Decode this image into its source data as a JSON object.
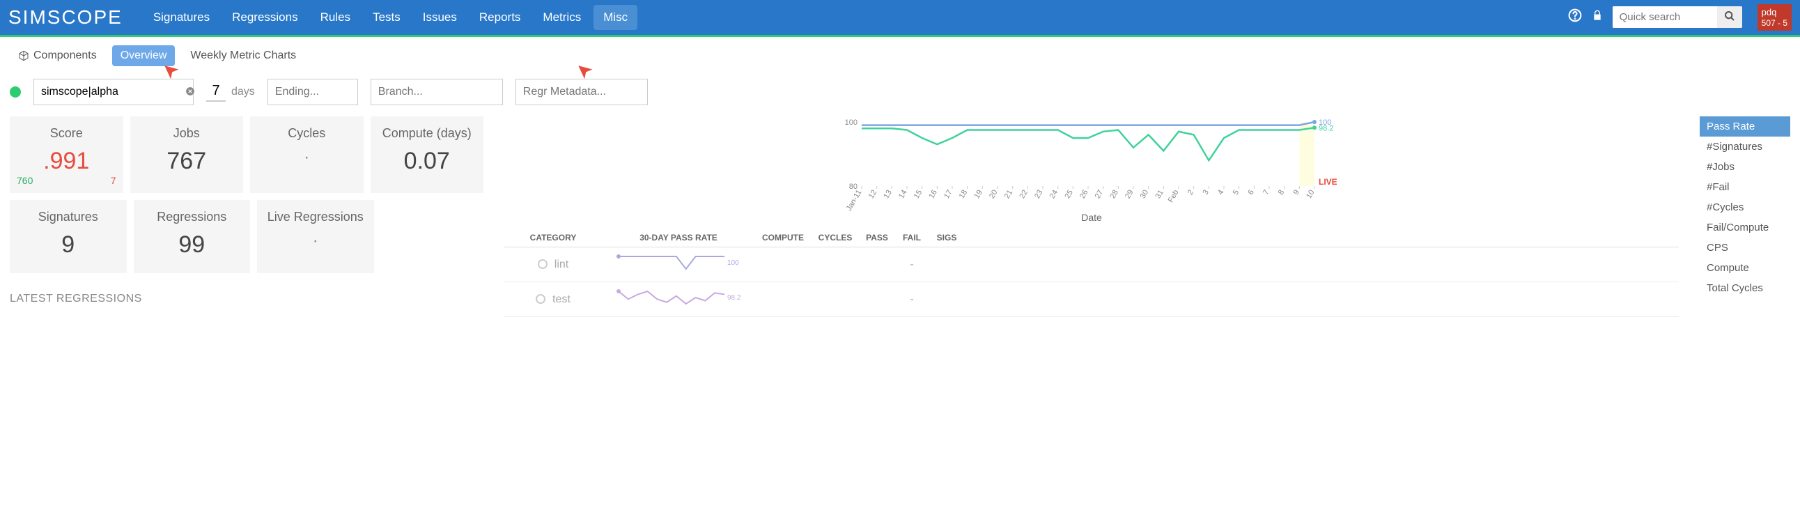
{
  "logo": "SIMSCOPE",
  "nav": {
    "items": [
      "Signatures",
      "Regressions",
      "Rules",
      "Tests",
      "Issues",
      "Reports",
      "Metrics",
      "Misc"
    ],
    "active": "Misc",
    "search_placeholder": "Quick search",
    "pdq": {
      "line1": "pdq",
      "line2": "507 - 5"
    }
  },
  "subnav": {
    "items": [
      "Components",
      "Overview",
      "Weekly Metric Charts"
    ],
    "active": "Overview"
  },
  "filters": {
    "component_value": "simscope|alpha",
    "days_value": "7",
    "days_label": "days",
    "ending_placeholder": "Ending...",
    "branch_placeholder": "Branch...",
    "regr_placeholder": "Regr Metadata..."
  },
  "stats": {
    "score": {
      "title": "Score",
      "value": ".991",
      "footer_left": "760",
      "footer_right": "7"
    },
    "jobs": {
      "title": "Jobs",
      "value": "767"
    },
    "cycles": {
      "title": "Cycles",
      "value": "·"
    },
    "compute": {
      "title": "Compute (days)",
      "value": "0.07"
    },
    "signatures": {
      "title": "Signatures",
      "value": "9"
    },
    "regressions": {
      "title": "Regressions",
      "value": "99"
    },
    "live_regressions": {
      "title": "Live Regressions",
      "value": "·"
    }
  },
  "chart_data": {
    "type": "line",
    "title": "",
    "xlabel": "Date",
    "ylabel": "",
    "ylim": [
      80,
      100
    ],
    "x_ticks": [
      "Jan-11",
      "12",
      "13",
      "14",
      "15",
      "16",
      "17",
      "18",
      "19",
      "20",
      "21",
      "22",
      "23",
      "24",
      "25",
      "26",
      "27",
      "28",
      "29",
      "30",
      "31",
      "Feb",
      "2",
      "3",
      "4",
      "5",
      "6",
      "7",
      "8",
      "9",
      "10"
    ],
    "series": [
      {
        "name": "blue",
        "color": "#7da4e8",
        "end_label": "100",
        "values": [
          99,
          99,
          99,
          99,
          99,
          99,
          99,
          99,
          99,
          99,
          99,
          99,
          99,
          99,
          99,
          99,
          99,
          99,
          99,
          99,
          99,
          99,
          99,
          99,
          99,
          99,
          99,
          99,
          99,
          99,
          100
        ]
      },
      {
        "name": "green",
        "color": "#3fd39b",
        "end_label": "98.2",
        "values": [
          98,
          98,
          98,
          97.5,
          95,
          93,
          95,
          97.5,
          97.5,
          97.5,
          97.5,
          97.5,
          97.5,
          97.5,
          95,
          95,
          97,
          97.5,
          92,
          96,
          91,
          97,
          96,
          88,
          95,
          97.5,
          97.5,
          97.5,
          97.5,
          97.5,
          98.2
        ]
      }
    ],
    "live_label": "LIVE"
  },
  "category_table": {
    "headers": {
      "cat": "CATEGORY",
      "spark": "30-DAY PASS RATE",
      "compute": "COMPUTE",
      "cycles": "CYCLES",
      "pass": "PASS",
      "fail": "FAIL",
      "sigs": "SIGS"
    },
    "rows": [
      {
        "name": "lint",
        "spark_label": "100",
        "spark_color": "#a9a9e0",
        "values": [
          100,
          100,
          100,
          100,
          100,
          100,
          100,
          95,
          100,
          100,
          100,
          100
        ],
        "fail": "-"
      },
      {
        "name": "test",
        "spark_label": "98.2",
        "spark_color": "#c9a9e0",
        "values": [
          100,
          95,
          98,
          100,
          95,
          93,
          97,
          92,
          96,
          94,
          99,
          98
        ],
        "fail": "-"
      }
    ]
  },
  "metrics_list": {
    "items": [
      "Pass Rate",
      "#Signatures",
      "#Jobs",
      "#Fail",
      "#Cycles",
      "Fail/Compute",
      "CPS",
      "Compute",
      "Total Cycles"
    ],
    "active": "Pass Rate"
  },
  "latest_regressions_label": "LATEST REGRESSIONS"
}
